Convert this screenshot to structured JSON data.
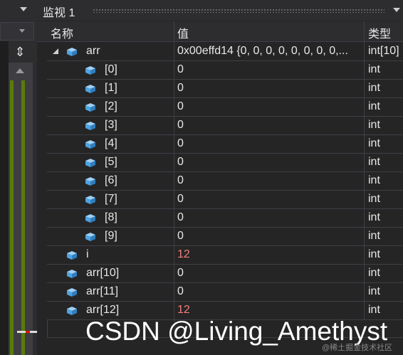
{
  "panel": {
    "title": "监视 1"
  },
  "columns": {
    "name": "名称",
    "value": "值",
    "type": "类型"
  },
  "rows": [
    {
      "name": "arr",
      "value": "0x00effd14 {0, 0, 0, 0, 0, 0, 0, 0,...",
      "type": "int[10]",
      "level": 0,
      "expanded": true,
      "changed": false
    },
    {
      "name": "[0]",
      "value": "0",
      "type": "int",
      "level": 1,
      "changed": false
    },
    {
      "name": "[1]",
      "value": "0",
      "type": "int",
      "level": 1,
      "changed": false
    },
    {
      "name": "[2]",
      "value": "0",
      "type": "int",
      "level": 1,
      "changed": false
    },
    {
      "name": "[3]",
      "value": "0",
      "type": "int",
      "level": 1,
      "changed": false
    },
    {
      "name": "[4]",
      "value": "0",
      "type": "int",
      "level": 1,
      "changed": false
    },
    {
      "name": "[5]",
      "value": "0",
      "type": "int",
      "level": 1,
      "changed": false
    },
    {
      "name": "[6]",
      "value": "0",
      "type": "int",
      "level": 1,
      "changed": false
    },
    {
      "name": "[7]",
      "value": "0",
      "type": "int",
      "level": 1,
      "changed": false
    },
    {
      "name": "[8]",
      "value": "0",
      "type": "int",
      "level": 1,
      "changed": false
    },
    {
      "name": "[9]",
      "value": "0",
      "type": "int",
      "level": 1,
      "changed": false
    },
    {
      "name": "i",
      "value": "12",
      "type": "int",
      "level": 0,
      "changed": true
    },
    {
      "name": "arr[10]",
      "value": "0",
      "type": "int",
      "level": 0,
      "changed": false
    },
    {
      "name": "arr[11]",
      "value": "0",
      "type": "int",
      "level": 0,
      "changed": false
    },
    {
      "name": "arr[12]",
      "value": "12",
      "type": "int",
      "level": 0,
      "changed": true
    }
  ],
  "watermark": {
    "main": "CSDN @Living_Amethyst",
    "small": "@稀土掘金技术社区"
  },
  "colors": {
    "changed_value": "#f47d7d",
    "cube_icon": "#4fa3e0",
    "background": "#252526"
  },
  "icons": {
    "variable": "cube-icon",
    "expand": "expand-arrow-icon",
    "split": "split-arrows-icon"
  }
}
